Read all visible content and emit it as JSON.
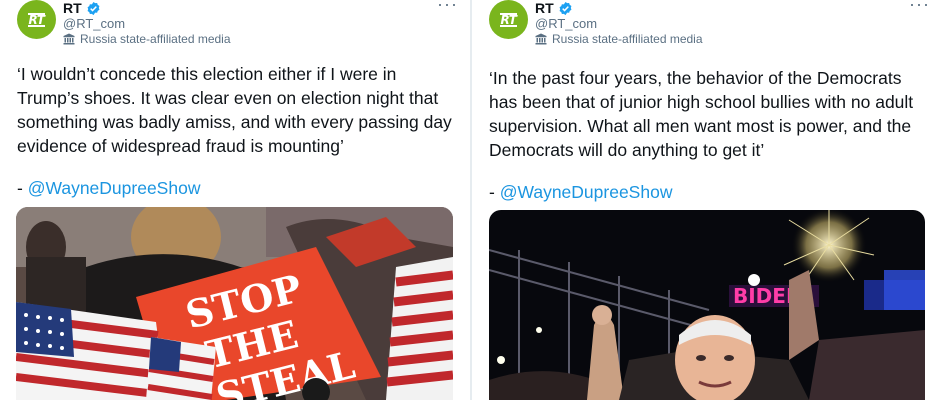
{
  "tweets": [
    {
      "author": {
        "avatar_text": "RT",
        "name": "RT",
        "handle": "@RT_com",
        "label": "Russia state-affiliated media"
      },
      "text": "‘I wouldn’t concede this election either if I were in\nTrump’s shoes. It was clear even on election night that\nsomething was badly amiss, and with every passing day\nevidence of widespread fraud is mounting’",
      "attribution_prefix": "- ",
      "mention": "@WayneDupreeShow",
      "media": {
        "sign_text": "STOP\nTHE\nSTEAL"
      }
    },
    {
      "author": {
        "avatar_text": "RT",
        "name": "RT",
        "handle": "@RT_com",
        "label": "Russia state-affiliated media"
      },
      "text": "‘In the past four years, the behavior of the Democrats\nhas been that of junior high school bullies with no adult\nsupervision. What all men want most is power, and the\nDemocrats will do anything to get it’",
      "attribution_prefix": "- ",
      "mention": "@WayneDupreeShow",
      "media": {
        "neon_text": "BIDEN"
      }
    }
  ],
  "colors": {
    "brand_green": "#7ab51d",
    "verified_blue": "#1da1f2",
    "link_blue": "#1b95e0",
    "secondary_gray": "#5b7083"
  },
  "icons": {
    "verified": "verified-badge-icon",
    "state_media": "building-icon",
    "more": "more-icon"
  }
}
